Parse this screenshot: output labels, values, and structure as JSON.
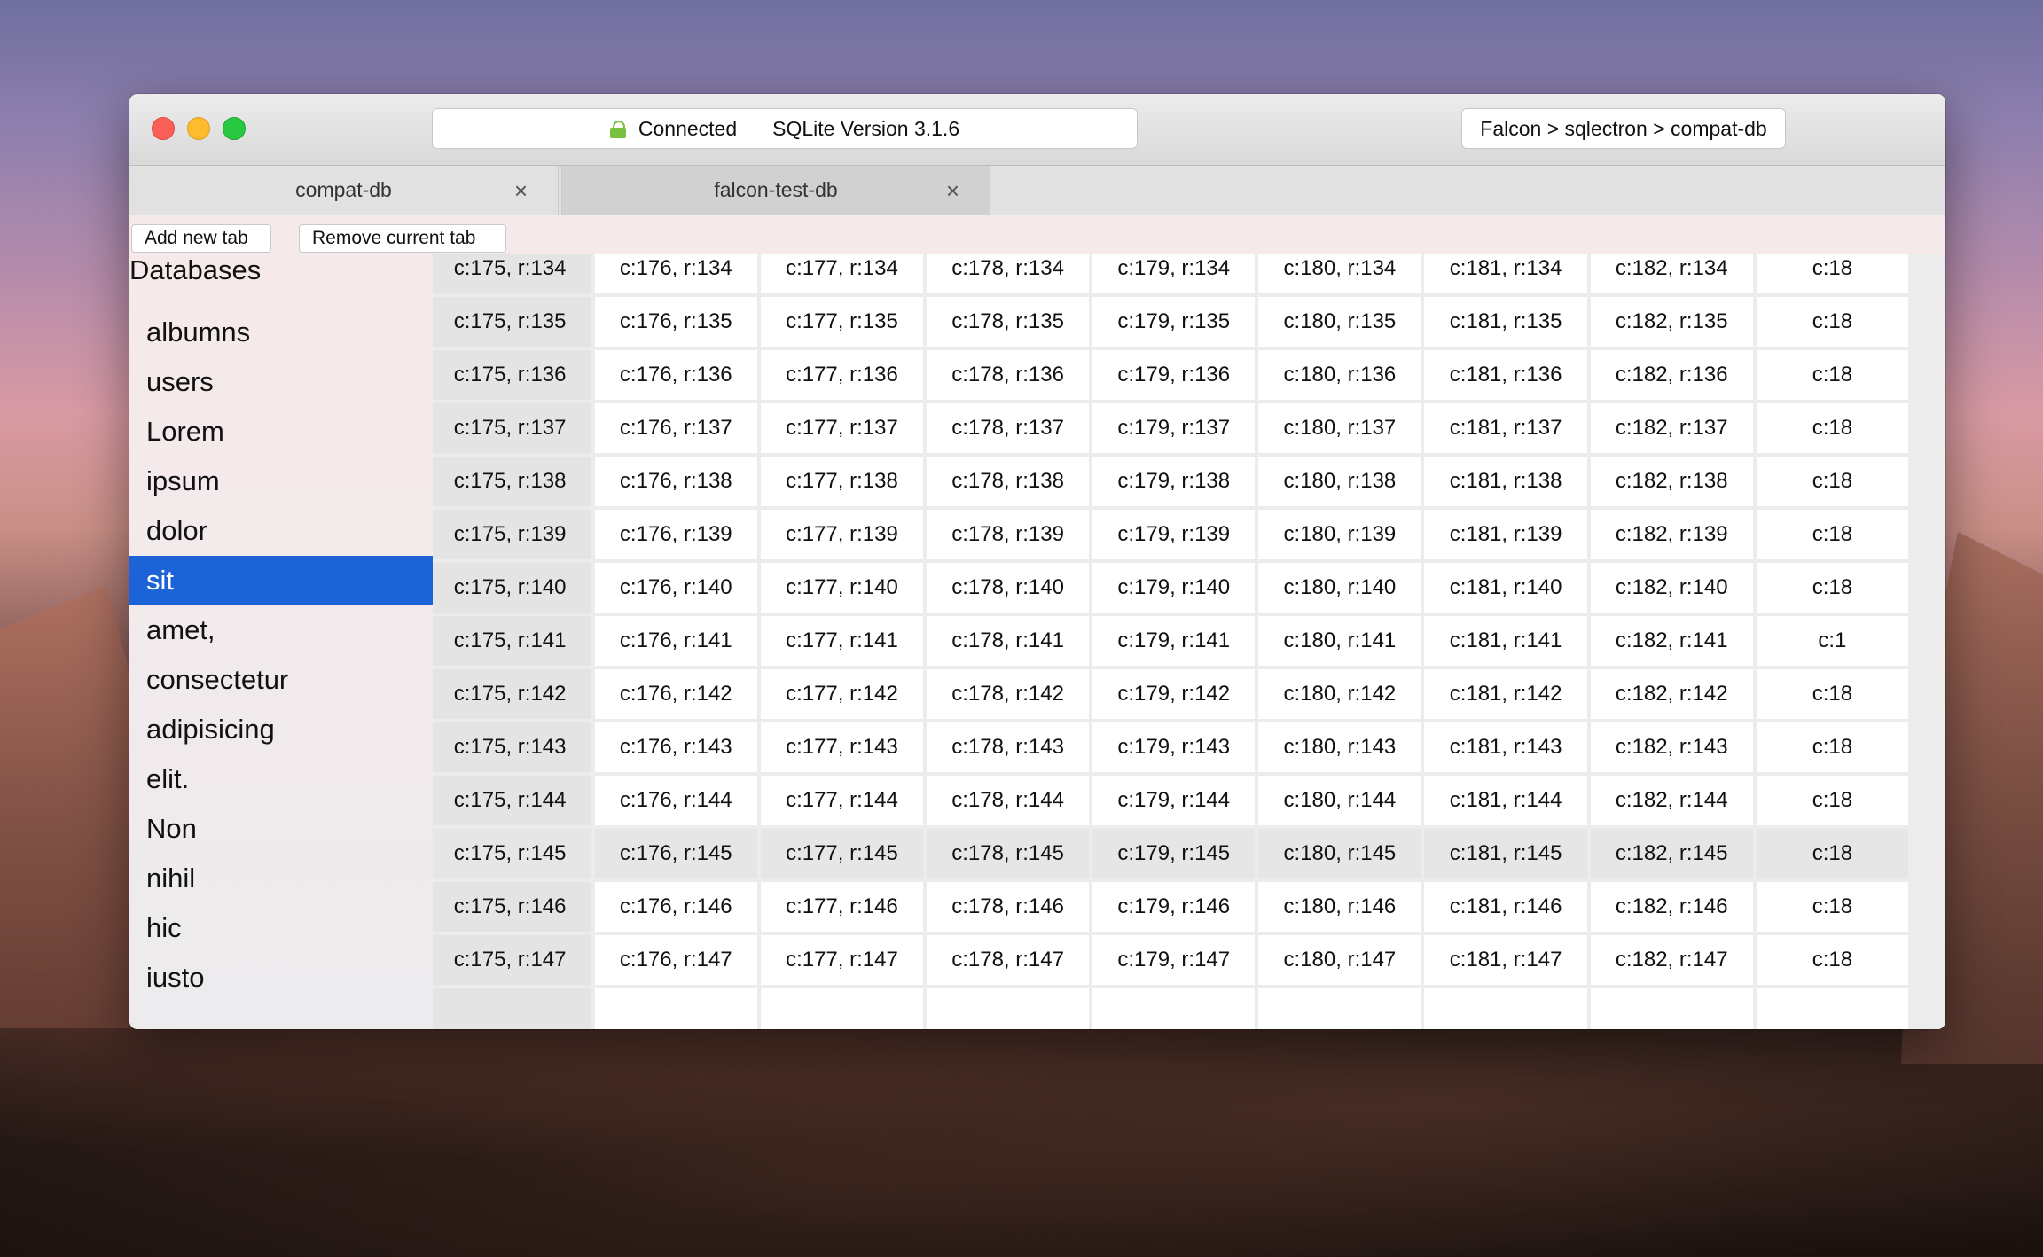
{
  "titlebar": {
    "status": "Connected",
    "version": "SQLite Version 3.1.6",
    "breadcrumb": "Falcon > sqlectron > compat-db"
  },
  "tabs": [
    {
      "label": "compat-db",
      "close": "×"
    },
    {
      "label": "falcon-test-db",
      "close": "×"
    }
  ],
  "toolbar": {
    "add_tab": "Add new tab",
    "remove_tab": "Remove current tab"
  },
  "sidebar": {
    "title": "Databases",
    "selected": "sit",
    "items": [
      "albumns",
      "users",
      "Lorem",
      "ipsum",
      "dolor",
      "sit",
      "amet,",
      "consectetur",
      "adipisicing",
      "elit.",
      "Non",
      "nihil",
      "hic",
      "iusto"
    ]
  },
  "table": {
    "highlighted_row": "r:145",
    "rows": [
      [
        "",
        "c:175, r:134",
        "c:176, r:134",
        "c:177, r:134",
        "c:178, r:134",
        "c:179, r:134",
        "c:180, r:134",
        "c:181, r:134",
        "c:182, r:134",
        "c:18"
      ],
      [
        "",
        "c:175, r:135",
        "c:176, r:135",
        "c:177, r:135",
        "c:178, r:135",
        "c:179, r:135",
        "c:180, r:135",
        "c:181, r:135",
        "c:182, r:135",
        "c:18"
      ],
      [
        "",
        "c:175, r:136",
        "c:176, r:136",
        "c:177, r:136",
        "c:178, r:136",
        "c:179, r:136",
        "c:180, r:136",
        "c:181, r:136",
        "c:182, r:136",
        "c:18"
      ],
      [
        "",
        "c:175, r:137",
        "c:176, r:137",
        "c:177, r:137",
        "c:178, r:137",
        "c:179, r:137",
        "c:180, r:137",
        "c:181, r:137",
        "c:182, r:137",
        "c:18"
      ],
      [
        "",
        "c:175, r:138",
        "c:176, r:138",
        "c:177, r:138",
        "c:178, r:138",
        "c:179, r:138",
        "c:180, r:138",
        "c:181, r:138",
        "c:182, r:138",
        "c:18"
      ],
      [
        "",
        "c:175, r:139",
        "c:176, r:139",
        "c:177, r:139",
        "c:178, r:139",
        "c:179, r:139",
        "c:180, r:139",
        "c:181, r:139",
        "c:182, r:139",
        "c:18"
      ],
      [
        "",
        "c:175, r:140",
        "c:176, r:140",
        "c:177, r:140",
        "c:178, r:140",
        "c:179, r:140",
        "c:180, r:140",
        "c:181, r:140",
        "c:182, r:140",
        "c:18"
      ],
      [
        "",
        "c:175, r:141",
        "c:176, r:141",
        "c:177, r:141",
        "c:178, r:141",
        "c:179, r:141",
        "c:180, r:141",
        "c:181, r:141",
        "c:182, r:141",
        "c:1"
      ],
      [
        "",
        "c:175, r:142",
        "c:176, r:142",
        "c:177, r:142",
        "c:178, r:142",
        "c:179, r:142",
        "c:180, r:142",
        "c:181, r:142",
        "c:182, r:142",
        "c:18"
      ],
      [
        "",
        "c:175, r:143",
        "c:176, r:143",
        "c:177, r:143",
        "c:178, r:143",
        "c:179, r:143",
        "c:180, r:143",
        "c:181, r:143",
        "c:182, r:143",
        "c:18"
      ],
      [
        "",
        "c:175, r:144",
        "c:176, r:144",
        "c:177, r:144",
        "c:178, r:144",
        "c:179, r:144",
        "c:180, r:144",
        "c:181, r:144",
        "c:182, r:144",
        "c:18"
      ],
      [
        "",
        "c:175, r:145",
        "c:176, r:145",
        "c:177, r:145",
        "c:178, r:145",
        "c:179, r:145",
        "c:180, r:145",
        "c:181, r:145",
        "c:182, r:145",
        "c:18"
      ],
      [
        "",
        "c:175, r:146",
        "c:176, r:146",
        "c:177, r:146",
        "c:178, r:146",
        "c:179, r:146",
        "c:180, r:146",
        "c:181, r:146",
        "c:182, r:146",
        "c:18"
      ],
      [
        "",
        "c:175, r:147",
        "c:176, r:147",
        "c:177, r:147",
        "c:178, r:147",
        "c:179, r:147",
        "c:180, r:147",
        "c:181, r:147",
        "c:182, r:147",
        "c:18"
      ],
      [
        "",
        "",
        "",
        "",
        "",
        "",
        "",
        "",
        "",
        ""
      ]
    ]
  },
  "colors": {
    "accent": "#1d63d8",
    "connected": "#7ac142",
    "close": "#fc5f57",
    "minimize": "#fdbc2e",
    "maximize": "#28c840"
  }
}
